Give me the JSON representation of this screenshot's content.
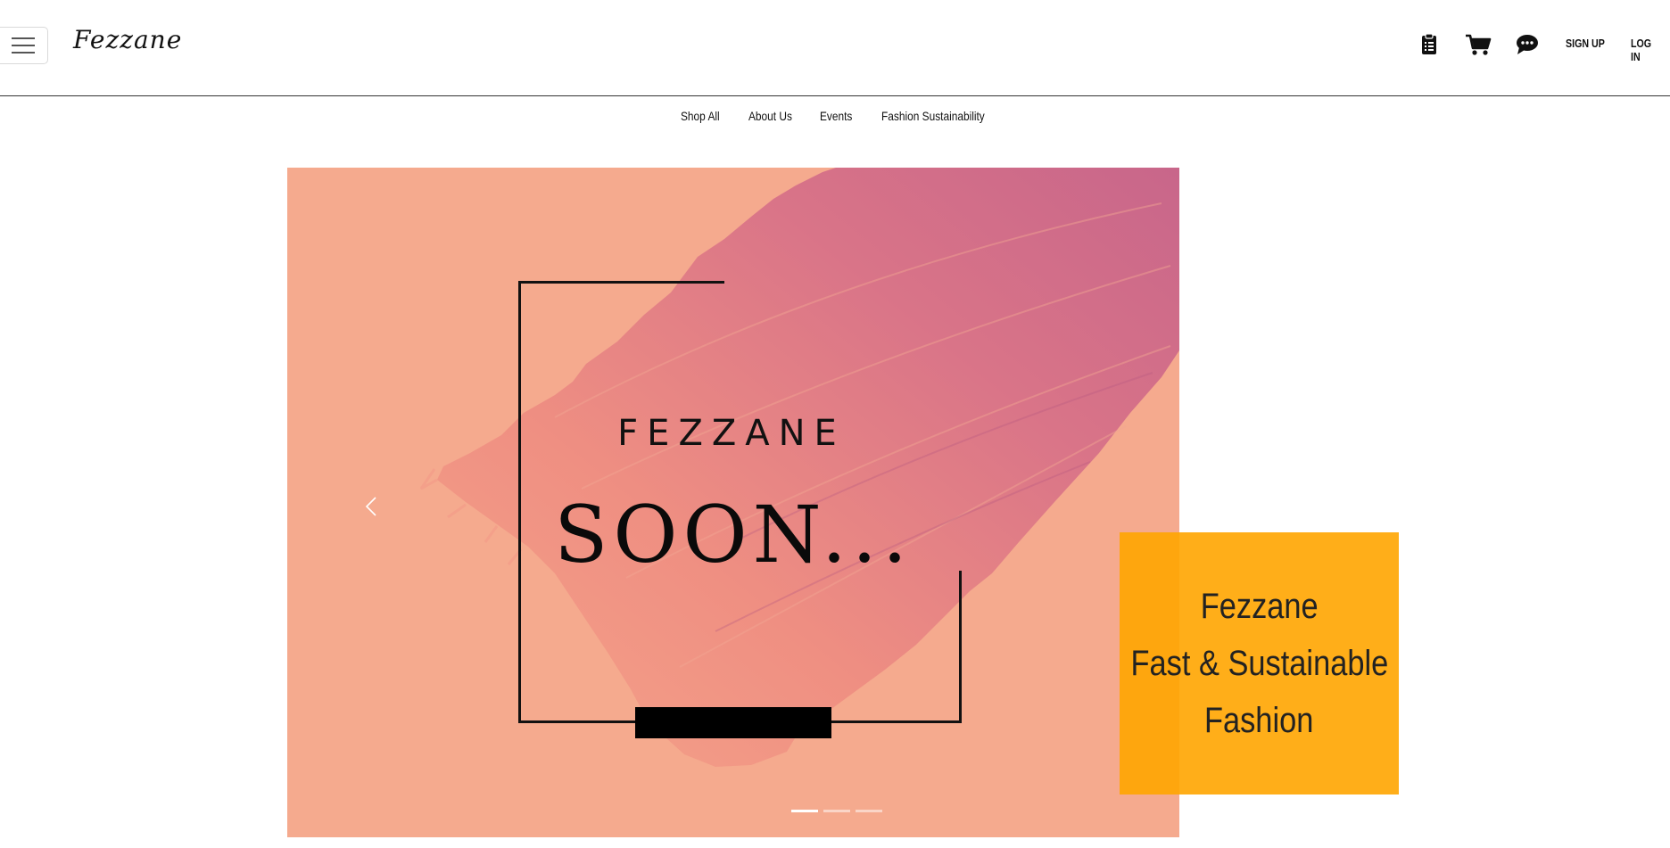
{
  "navbar": {
    "menu_label": "Toggle menu",
    "brand": "Fezzane",
    "icons": [
      "clipboard-icon",
      "cart-icon",
      "chat-icon"
    ],
    "signup": "SIGN UP",
    "login": "LOG IN"
  },
  "subnav": {
    "items": [
      {
        "label": "Shop All"
      },
      {
        "label": "About Us"
      },
      {
        "label": "Events"
      },
      {
        "label": "Fashion Sustainability"
      }
    ]
  },
  "carousel": {
    "slide_brand": "FEZZANE",
    "slide_headline": "SOON...",
    "active_slide_index": 0,
    "slide_count": 3,
    "colors": {
      "background": "#f5aa8e",
      "stroke_light": "#f08e7e",
      "stroke_dark": "#c96a8a",
      "frame": "#111111"
    }
  },
  "promo": {
    "line1": "Fezzane",
    "line2": "Fast & Sustainable",
    "line3": "Fashion",
    "background": "#ffa500"
  }
}
